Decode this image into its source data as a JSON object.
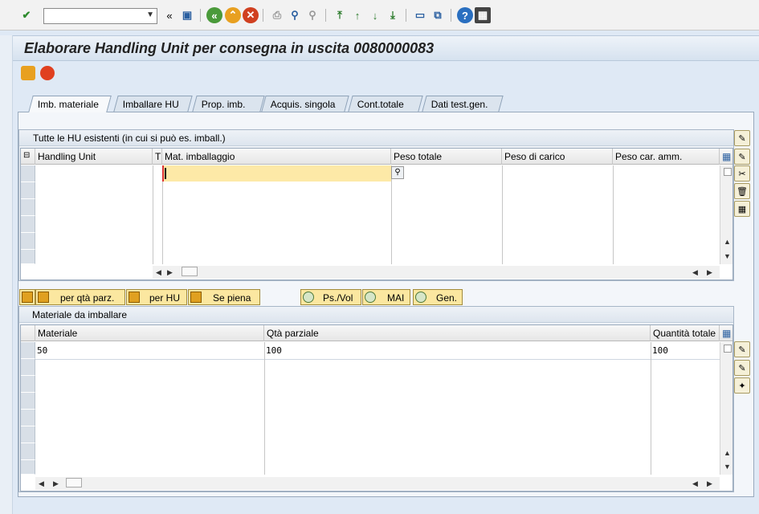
{
  "toolbar": {
    "command_field_value": "",
    "icons": [
      "enter-icon",
      "command-dropdown-icon",
      "collapse-icon",
      "save-icon",
      "back-icon",
      "exit-icon",
      "cancel-icon",
      "print-icon",
      "find-icon",
      "find-next-icon",
      "first-page-icon",
      "previous-page-icon",
      "next-page-icon",
      "last-page-icon",
      "new-session-icon",
      "shortcut-icon",
      "help-icon",
      "customize-layout-icon"
    ],
    "collapse_glyph": "«"
  },
  "title": "Elaborare Handling Unit per consegna in uscita 0080000083",
  "tabs": [
    {
      "label": "Imb. materiale",
      "active": true
    },
    {
      "label": "Imballare HU",
      "active": false
    },
    {
      "label": "Prop. imb.",
      "active": false
    },
    {
      "label": "Acquis. singola",
      "active": false
    },
    {
      "label": "Cont.totale",
      "active": false
    },
    {
      "label": "Dati test.gen.",
      "active": false
    }
  ],
  "hu_group": {
    "title": "Tutte le HU esistenti (in cui si può es. imball.)",
    "columns": [
      "Handling Unit",
      "T",
      "Mat. imballaggio",
      "Peso totale",
      "Peso di carico",
      "Peso car. amm."
    ],
    "input_value": ""
  },
  "buttons": {
    "partial_qty": "per qtà parz.",
    "per_hu": "per HU",
    "if_full": "Se piena",
    "weight_volume": "Ps./Vol",
    "mai": "MAI",
    "gen": "Gen."
  },
  "material_group": {
    "title": "Materiale da imballare",
    "columns": [
      "Materiale",
      "Qtà parziale",
      "Quantità totale"
    ],
    "rows": [
      {
        "material": "50",
        "partial_qty": "100",
        "total_qty": "100"
      }
    ]
  },
  "colors": {
    "accent_yellow": "#fde9a7",
    "panel_blue": "#dfe9f5",
    "input_border_red": "#dd3333"
  }
}
